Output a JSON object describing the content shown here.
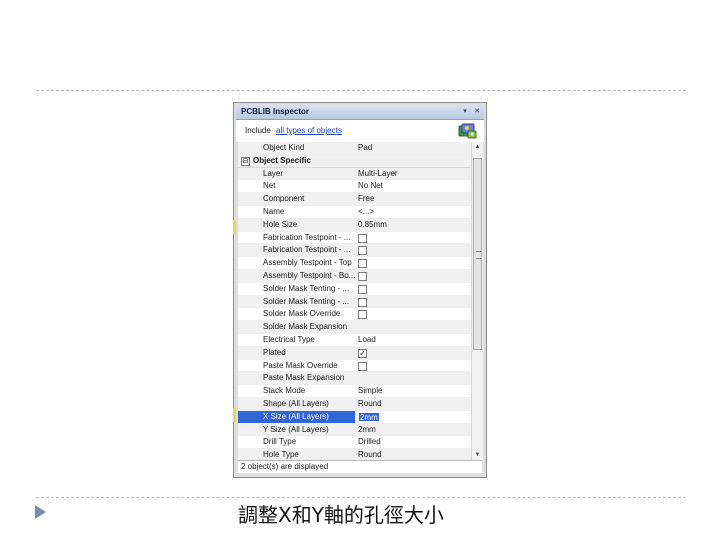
{
  "inspector": {
    "title": "PCBLIB Inspector",
    "menu_glyph": "▾",
    "close_glyph": "✕",
    "filter_prefix": "Include",
    "filter_link": "all types of objects",
    "status": "2 object(s) are displayed"
  },
  "rows": [
    {
      "name": "Object Kind",
      "value": "Pad"
    },
    {
      "category": "Object Specific",
      "expander": "⊟"
    },
    {
      "name": "Layer",
      "value": "Multi-Layer"
    },
    {
      "name": "Net",
      "value": "No Net"
    },
    {
      "name": "Component",
      "value": "Free"
    },
    {
      "name": "Name",
      "value": "<...>"
    },
    {
      "name": "Hole Size",
      "value": "0.85mm"
    },
    {
      "name": "Fabrication Testpoint - ...",
      "checkbox": false
    },
    {
      "name": "Fabrication Testpoint - ...",
      "checkbox": false
    },
    {
      "name": "Assembly Testpoint - Top",
      "checkbox": false
    },
    {
      "name": "Assembly Testpoint - Bo...",
      "checkbox": false
    },
    {
      "name": "Solder Mask Tenting - ...",
      "checkbox": false
    },
    {
      "name": "Solder Mask Tenting - ...",
      "checkbox": false
    },
    {
      "name": "Solder Mask Override",
      "checkbox": false
    },
    {
      "name": "Solder Mask Expansion",
      "value": ""
    },
    {
      "name": "Electrical Type",
      "value": "Load"
    },
    {
      "name": "Plated",
      "checkbox": true
    },
    {
      "name": "Paste Mask Override",
      "checkbox": false
    },
    {
      "name": "Paste Mask Expansion",
      "value": ""
    },
    {
      "name": "Stack Mode",
      "value": "Simple"
    },
    {
      "name": "Shape (All Layers)",
      "value": "Round"
    },
    {
      "name": "X Size (All Layers)",
      "value": "2mm",
      "selected": true
    },
    {
      "name": "Y Size (All Layers)",
      "value": "2mm"
    },
    {
      "name": "Drill Type",
      "value": "Drilled"
    },
    {
      "name": "Hole Type",
      "value": "Round"
    }
  ],
  "caption": "調整X和Y軸的孔徑大小",
  "colors": {
    "selection": "#3166d9",
    "link": "#1f42c9",
    "bullet": "#7a8aa8"
  }
}
